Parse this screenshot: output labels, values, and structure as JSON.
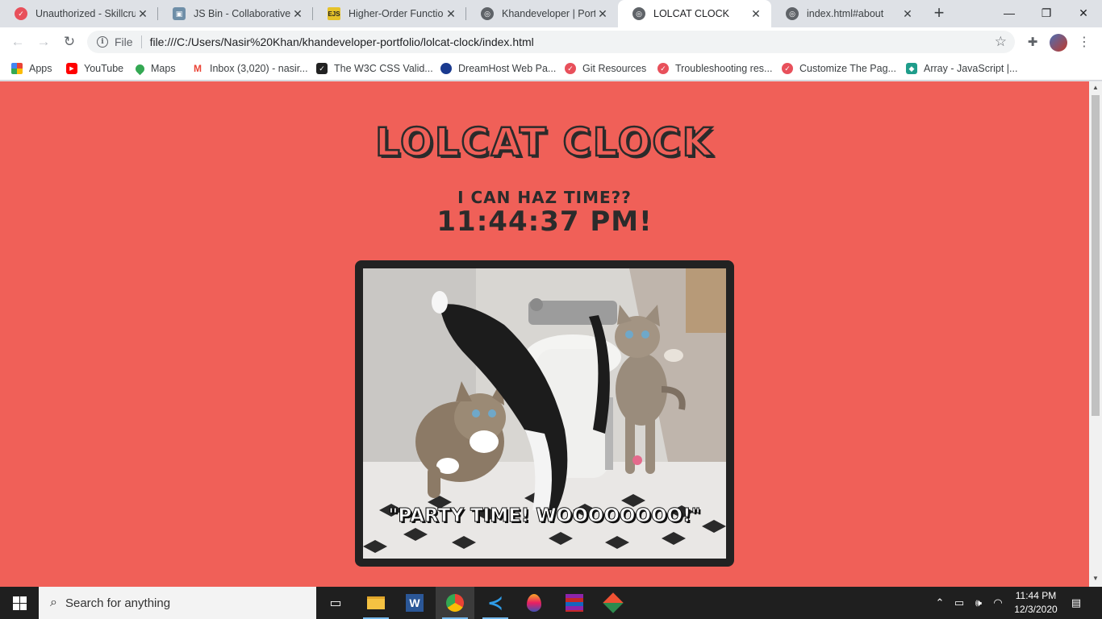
{
  "browser": {
    "tabs": [
      {
        "title": "Unauthorized - Skillcrush",
        "favicon_color": "#e8505b",
        "favicon_glyph": ""
      },
      {
        "title": "JS Bin - Collaborative JavaScript",
        "favicon_color": "#6f8fa8",
        "favicon_glyph": ""
      },
      {
        "title": "Higher-Order Functions",
        "favicon_color": "#e6c229",
        "favicon_glyph": "EJS"
      },
      {
        "title": "Khandeveloper | Portfolio",
        "favicon_color": "#5f6368",
        "favicon_glyph": ""
      },
      {
        "title": "LOLCAT CLOCK",
        "favicon_color": "#5f6368",
        "favicon_glyph": "",
        "active": true
      },
      {
        "title": "index.html#about",
        "favicon_color": "#5f6368",
        "favicon_glyph": ""
      }
    ],
    "new_tab_label": "+",
    "window_controls": {
      "minimize": "—",
      "maximize": "❐",
      "close": "✕"
    },
    "omnibox": {
      "scheme_label": "File",
      "url": "file:///C:/Users/Nasir%20Khan/khandeveloper-portfolio/lolcat-clock/index.html"
    },
    "bookmarks": [
      {
        "label": "Apps",
        "icon": "apps-grid-icon",
        "color": "#4285f4"
      },
      {
        "label": "YouTube",
        "icon": "youtube-icon",
        "color": "#ff0000"
      },
      {
        "label": "Maps",
        "icon": "maps-pin-icon",
        "color": "#34a853"
      },
      {
        "label": "Inbox (3,020) - nasir...",
        "icon": "gmail-icon",
        "color": "#ea4335"
      },
      {
        "label": "The W3C CSS Valid...",
        "icon": "w3c-icon",
        "color": "#222222"
      },
      {
        "label": "DreamHost Web Pa...",
        "icon": "dreamhost-icon",
        "color": "#1a3a8f"
      },
      {
        "label": "Git Resources",
        "icon": "skillcrush-icon",
        "color": "#e8505b"
      },
      {
        "label": "Troubleshooting res...",
        "icon": "skillcrush-icon",
        "color": "#e8505b"
      },
      {
        "label": "Customize The Pag...",
        "icon": "skillcrush-icon",
        "color": "#e8505b"
      },
      {
        "label": "Array - JavaScript |...",
        "icon": "mdn-icon",
        "color": "#1f9d8b"
      }
    ]
  },
  "page": {
    "background_color": "#f06058",
    "title": "LOLCAT CLOCK",
    "subtitle": "I CAN HAZ TIME??",
    "time": "11:44:37 PM!",
    "image_caption": "\"PARTY TIME! WOOOOOOOO!\""
  },
  "taskbar": {
    "search_placeholder": "Search for anything",
    "apps": [
      "task-view-icon",
      "file-explorer-icon",
      "word-icon",
      "chrome-icon",
      "vscode-icon",
      "paint3d-icon",
      "winrar-icon",
      "git-icon"
    ],
    "clock_time": "11:44 PM",
    "clock_date": "12/3/2020"
  }
}
